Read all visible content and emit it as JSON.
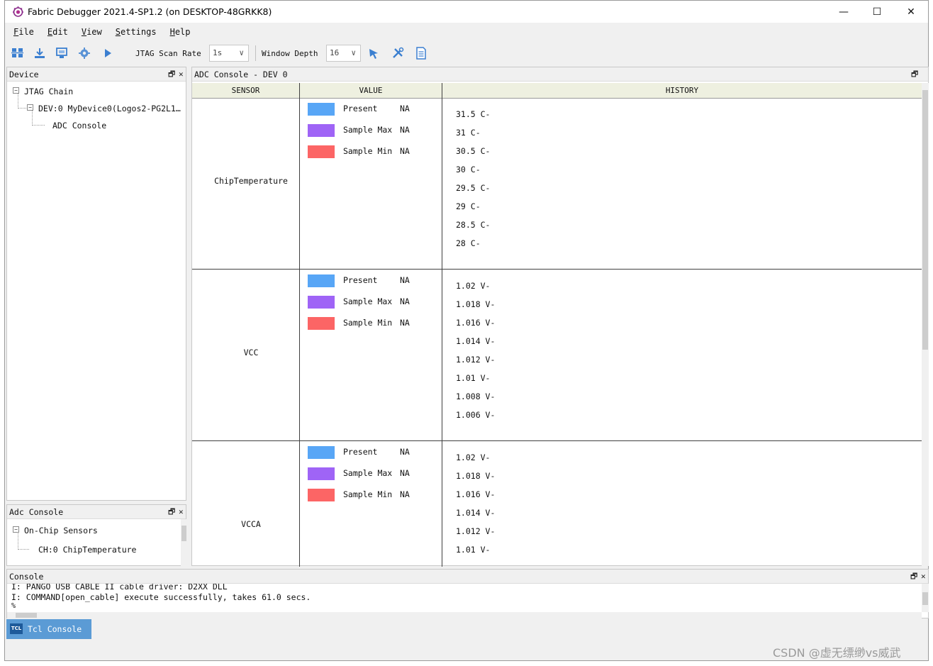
{
  "window": {
    "title": "Fabric Debugger 2021.4-SP1.2 (on DESKTOP-48GRKK8)",
    "controls": {
      "minimize": "—",
      "maximize": "☐",
      "close": "✕"
    }
  },
  "menu": [
    {
      "ul": "F",
      "rest": "ile"
    },
    {
      "ul": "E",
      "rest": "dit"
    },
    {
      "ul": "V",
      "rest": "iew"
    },
    {
      "ul": "S",
      "rest": "ettings"
    },
    {
      "ul": "H",
      "rest": "elp"
    }
  ],
  "toolbar": {
    "scan_rate_label": "JTAG Scan Rate",
    "scan_rate_value": "1s",
    "window_depth_label": "Window Depth",
    "window_depth_value": "16",
    "dropdown_arrow": "∨"
  },
  "device_panel": {
    "title": "Device",
    "tree": {
      "root": "JTAG Chain",
      "device": "DEV:0 MyDevice0(Logos2-PG2L1…",
      "leaf": "ADC Console",
      "expand_symbol": "−"
    }
  },
  "adc_panel": {
    "title": "Adc Console",
    "tree": {
      "root": "On-Chip Sensors",
      "leaf": "CH:0 ChipTemperature",
      "expand_symbol": "−"
    }
  },
  "panel_controls": {
    "restore": "🗗",
    "close": "✕"
  },
  "adc_console": {
    "title": "ADC Console - DEV 0",
    "columns": {
      "sensor": "SENSOR",
      "value": "VALUE",
      "history": "HISTORY"
    },
    "legend_colors": {
      "present": "#58a6f6",
      "sample_max": "#9f64f6",
      "sample_min": "#fc6565"
    },
    "sensors": [
      {
        "name": "ChipTemperature",
        "legend": [
          {
            "label": "Present",
            "value": "NA"
          },
          {
            "label": "Sample Max",
            "value": "NA"
          },
          {
            "label": "Sample Min",
            "value": "NA"
          }
        ],
        "history_ticks": [
          "31.5 C-",
          "31 C-",
          "30.5 C-",
          "30 C-",
          "29.5 C-",
          "29 C-",
          "28.5 C-",
          "28 C-"
        ]
      },
      {
        "name": "VCC",
        "legend": [
          {
            "label": "Present",
            "value": "NA"
          },
          {
            "label": "Sample Max",
            "value": "NA"
          },
          {
            "label": "Sample Min",
            "value": "NA"
          }
        ],
        "history_ticks": [
          "1.02 V-",
          "1.018 V-",
          "1.016 V-",
          "1.014 V-",
          "1.012 V-",
          "1.01 V-",
          "1.008 V-",
          "1.006 V-"
        ]
      },
      {
        "name": "VCCA",
        "legend": [
          {
            "label": "Present",
            "value": "NA"
          },
          {
            "label": "Sample Max",
            "value": "NA"
          },
          {
            "label": "Sample Min",
            "value": "NA"
          }
        ],
        "history_ticks": [
          "1.02 V-",
          "1.018 V-",
          "1.016 V-",
          "1.014 V-",
          "1.012 V-",
          "1.01 V-"
        ]
      }
    ]
  },
  "console": {
    "title": "Console",
    "lines": [
      "I: PANGO USB CABLE II cable driver: D2XX DLL",
      "I: COMMAND[open_cable] execute successfully, takes 61.0 secs.",
      "%"
    ]
  },
  "tabs": {
    "tcl_console": "Tcl Console",
    "tcl_icon_text": "TCL"
  },
  "watermark": "CSDN @虚无缥缈vs威武"
}
